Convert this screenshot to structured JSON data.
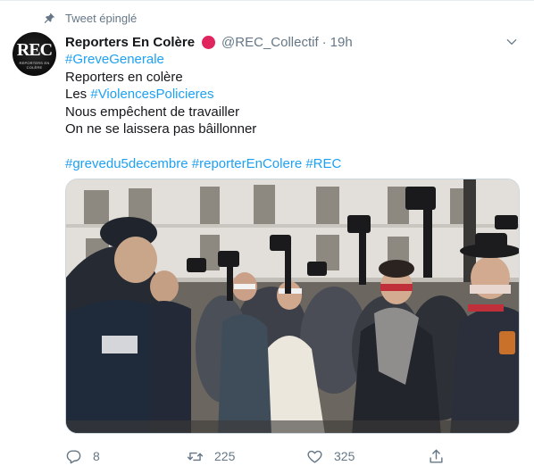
{
  "pinned": {
    "label": "Tweet épinglé",
    "icon": "pin-icon"
  },
  "author": {
    "avatar_text": "REC",
    "avatar_subtext": "REPORTERS EN COLÈRE",
    "display_name": "Reporters En Colère",
    "handle": "@REC_Collectif",
    "separator": "·",
    "time": "19h",
    "badge_color": "#e0245e"
  },
  "tweet": {
    "hashtag1": "#GreveGenerale",
    "line2": "Reporters en colère",
    "line3_prefix": "Les ",
    "hashtag2": "#ViolencesPolicieres",
    "line4": "Nous empêchent de travailler",
    "line5": "On ne se laissera pas bâillonner",
    "tag_a": "#grevedu5decembre",
    "tag_b": "#reporterEnColere",
    "tag_c": "#REC"
  },
  "media": {
    "icon": "photo"
  },
  "actions": {
    "reply_count": "8",
    "retweet_count": "225",
    "like_count": "325"
  },
  "colors": {
    "accent": "#1da1f2",
    "muted": "#657786",
    "text": "#14171a"
  }
}
